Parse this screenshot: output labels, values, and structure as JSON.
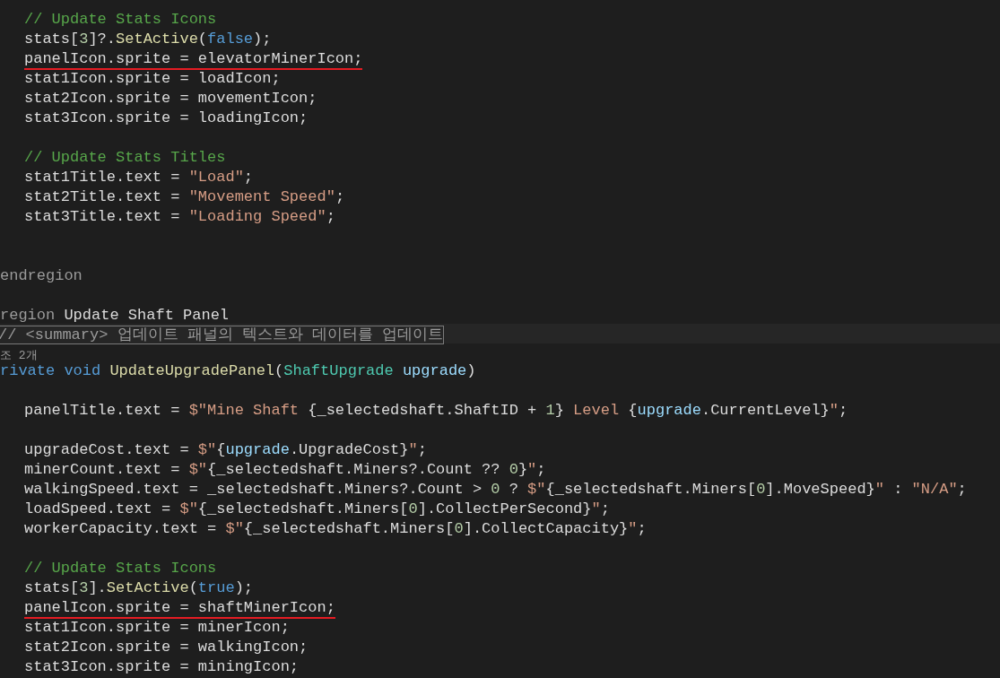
{
  "editor": {
    "lines": [
      {
        "kind": "body",
        "tokens": [
          {
            "text": "// Update Stats Icons",
            "kind": "comment"
          }
        ]
      },
      {
        "kind": "body",
        "tokens": [
          {
            "text": "stats[",
            "kind": "plain"
          },
          {
            "text": "3",
            "kind": "number"
          },
          {
            "text": "]?.",
            "kind": "plain"
          },
          {
            "text": "SetActive",
            "kind": "method"
          },
          {
            "text": "(",
            "kind": "plain"
          },
          {
            "text": "false",
            "kind": "keyword"
          },
          {
            "text": ");",
            "kind": "plain"
          }
        ]
      },
      {
        "kind": "body",
        "underlined": true,
        "tokens": [
          {
            "text": "panelIcon.sprite = elevatorMinerIcon;",
            "kind": "plain"
          }
        ]
      },
      {
        "kind": "body",
        "tokens": [
          {
            "text": "stat1Icon.sprite = loadIcon;",
            "kind": "plain"
          }
        ]
      },
      {
        "kind": "body",
        "tokens": [
          {
            "text": "stat2Icon.sprite = movementIcon;",
            "kind": "plain"
          }
        ]
      },
      {
        "kind": "body",
        "tokens": [
          {
            "text": "stat3Icon.sprite = loadingIcon;",
            "kind": "plain"
          }
        ]
      },
      {
        "kind": "blank"
      },
      {
        "kind": "body",
        "tokens": [
          {
            "text": "// Update Stats Titles",
            "kind": "comment"
          }
        ]
      },
      {
        "kind": "body",
        "tokens": [
          {
            "text": "stat1Title.text = ",
            "kind": "plain"
          },
          {
            "text": "\"Load\"",
            "kind": "string"
          },
          {
            "text": ";",
            "kind": "plain"
          }
        ]
      },
      {
        "kind": "body",
        "tokens": [
          {
            "text": "stat2Title.text = ",
            "kind": "plain"
          },
          {
            "text": "\"Movement Speed\"",
            "kind": "string"
          },
          {
            "text": ";",
            "kind": "plain"
          }
        ]
      },
      {
        "kind": "body",
        "tokens": [
          {
            "text": "stat3Title.text = ",
            "kind": "plain"
          },
          {
            "text": "\"Loading Speed\"",
            "kind": "string"
          },
          {
            "text": ";",
            "kind": "plain"
          }
        ]
      },
      {
        "kind": "blank"
      },
      {
        "kind": "blank"
      },
      {
        "kind": "edge",
        "tokens": [
          {
            "text": "endregion",
            "kind": "region"
          }
        ]
      },
      {
        "kind": "blank"
      },
      {
        "kind": "edge",
        "tokens": [
          {
            "text": "region ",
            "kind": "region"
          },
          {
            "text": "Update Shaft Panel",
            "kind": "plain"
          }
        ]
      },
      {
        "kind": "summary",
        "tokens": [
          {
            "text": "// <summary> 업데이트 패널의 텍스트와 데이터를 업데이트",
            "kind": "region"
          }
        ]
      },
      {
        "kind": "codelens",
        "tokens": [
          {
            "text": "조 2개",
            "kind": "region"
          }
        ]
      },
      {
        "kind": "edge",
        "tokens": [
          {
            "text": "rivate void ",
            "kind": "keyword"
          },
          {
            "text": "UpdateUpgradePanel",
            "kind": "method"
          },
          {
            "text": "(",
            "kind": "plain"
          },
          {
            "text": "ShaftUpgrade",
            "kind": "type"
          },
          {
            "text": " upgrade",
            "kind": "param"
          },
          {
            "text": ")",
            "kind": "plain"
          }
        ]
      },
      {
        "kind": "blank"
      },
      {
        "kind": "body",
        "tokens": [
          {
            "text": "panelTitle.text = ",
            "kind": "plain"
          },
          {
            "text": "$\"Mine Shaft ",
            "kind": "string"
          },
          {
            "text": "{_selectedshaft.ShaftID + ",
            "kind": "plain"
          },
          {
            "text": "1",
            "kind": "number"
          },
          {
            "text": "}",
            "kind": "plain"
          },
          {
            "text": " Level ",
            "kind": "string"
          },
          {
            "text": "{",
            "kind": "plain"
          },
          {
            "text": "upgrade",
            "kind": "param"
          },
          {
            "text": ".CurrentLevel}",
            "kind": "plain"
          },
          {
            "text": "\"",
            "kind": "string"
          },
          {
            "text": ";",
            "kind": "plain"
          }
        ]
      },
      {
        "kind": "blank"
      },
      {
        "kind": "body",
        "tokens": [
          {
            "text": "upgradeCost.text = ",
            "kind": "plain"
          },
          {
            "text": "$\"",
            "kind": "string"
          },
          {
            "text": "{",
            "kind": "plain"
          },
          {
            "text": "upgrade",
            "kind": "param"
          },
          {
            "text": ".UpgradeCost}",
            "kind": "plain"
          },
          {
            "text": "\"",
            "kind": "string"
          },
          {
            "text": ";",
            "kind": "plain"
          }
        ]
      },
      {
        "kind": "body",
        "tokens": [
          {
            "text": "minerCount.text = ",
            "kind": "plain"
          },
          {
            "text": "$\"",
            "kind": "string"
          },
          {
            "text": "{_selectedshaft.Miners?.Count ?? ",
            "kind": "plain"
          },
          {
            "text": "0",
            "kind": "number"
          },
          {
            "text": "}",
            "kind": "plain"
          },
          {
            "text": "\"",
            "kind": "string"
          },
          {
            "text": ";",
            "kind": "plain"
          }
        ]
      },
      {
        "kind": "body",
        "tokens": [
          {
            "text": "walkingSpeed.text = _selectedshaft.Miners?.Count > ",
            "kind": "plain"
          },
          {
            "text": "0",
            "kind": "number"
          },
          {
            "text": " ? ",
            "kind": "plain"
          },
          {
            "text": "$\"",
            "kind": "string"
          },
          {
            "text": "{_selectedshaft.Miners[",
            "kind": "plain"
          },
          {
            "text": "0",
            "kind": "number"
          },
          {
            "text": "].MoveSpeed}",
            "kind": "plain"
          },
          {
            "text": "\"",
            "kind": "string"
          },
          {
            "text": " : ",
            "kind": "plain"
          },
          {
            "text": "\"N/A\"",
            "kind": "string"
          },
          {
            "text": ";",
            "kind": "plain"
          }
        ]
      },
      {
        "kind": "body",
        "tokens": [
          {
            "text": "loadSpeed.text = ",
            "kind": "plain"
          },
          {
            "text": "$\"",
            "kind": "string"
          },
          {
            "text": "{_selectedshaft.Miners[",
            "kind": "plain"
          },
          {
            "text": "0",
            "kind": "number"
          },
          {
            "text": "].CollectPerSecond}",
            "kind": "plain"
          },
          {
            "text": "\"",
            "kind": "string"
          },
          {
            "text": ";",
            "kind": "plain"
          }
        ]
      },
      {
        "kind": "body",
        "tokens": [
          {
            "text": "workerCapacity.text = ",
            "kind": "plain"
          },
          {
            "text": "$\"",
            "kind": "string"
          },
          {
            "text": "{_selectedshaft.Miners[",
            "kind": "plain"
          },
          {
            "text": "0",
            "kind": "number"
          },
          {
            "text": "].CollectCapacity}",
            "kind": "plain"
          },
          {
            "text": "\"",
            "kind": "string"
          },
          {
            "text": ";",
            "kind": "plain"
          }
        ]
      },
      {
        "kind": "blank"
      },
      {
        "kind": "body",
        "tokens": [
          {
            "text": "// Update Stats Icons",
            "kind": "comment"
          }
        ]
      },
      {
        "kind": "body",
        "tokens": [
          {
            "text": "stats[",
            "kind": "plain"
          },
          {
            "text": "3",
            "kind": "number"
          },
          {
            "text": "].",
            "kind": "plain"
          },
          {
            "text": "SetActive",
            "kind": "method"
          },
          {
            "text": "(",
            "kind": "plain"
          },
          {
            "text": "true",
            "kind": "keyword"
          },
          {
            "text": ");",
            "kind": "plain"
          }
        ]
      },
      {
        "kind": "body",
        "underlined": true,
        "tokens": [
          {
            "text": "panelIcon.sprite = shaftMinerIcon;",
            "kind": "plain"
          }
        ]
      },
      {
        "kind": "body",
        "tokens": [
          {
            "text": "stat1Icon.sprite = minerIcon;",
            "kind": "plain"
          }
        ]
      },
      {
        "kind": "body",
        "tokens": [
          {
            "text": "stat2Icon.sprite = walkingIcon;",
            "kind": "plain"
          }
        ]
      },
      {
        "kind": "body",
        "tokens": [
          {
            "text": "stat3Icon.sprite = miningIcon;",
            "kind": "plain"
          }
        ]
      }
    ]
  }
}
